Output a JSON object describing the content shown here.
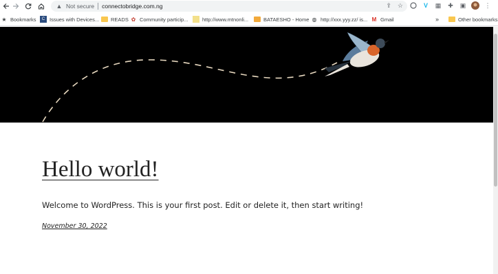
{
  "browser": {
    "security_label": "Not secure",
    "url": "connectobridge.com.ng"
  },
  "bookmarks": [
    {
      "label": "Bookmarks",
      "icon": "star-icon"
    },
    {
      "label": "Issues with Devices...",
      "icon": "page-icon"
    },
    {
      "label": "READS",
      "icon": "folder-icon"
    },
    {
      "label": "Community particip...",
      "icon": "community-icon"
    },
    {
      "label": "http://www.mtnonli...",
      "icon": "page-icon"
    },
    {
      "label": "BATAESHO - Home",
      "icon": "folder-icon"
    },
    {
      "label": "http://xxx.yyy.zz/ is...",
      "icon": "globe-icon"
    },
    {
      "label": "Gmail",
      "icon": "gmail-icon"
    },
    {
      "label": "Other bookmarks",
      "icon": "folder-icon"
    }
  ],
  "post": {
    "title": "Hello world!",
    "excerpt": "Welcome to WordPress. This is your first post. Edit or delete it, then start writing!",
    "date": "November 30, 2022"
  }
}
